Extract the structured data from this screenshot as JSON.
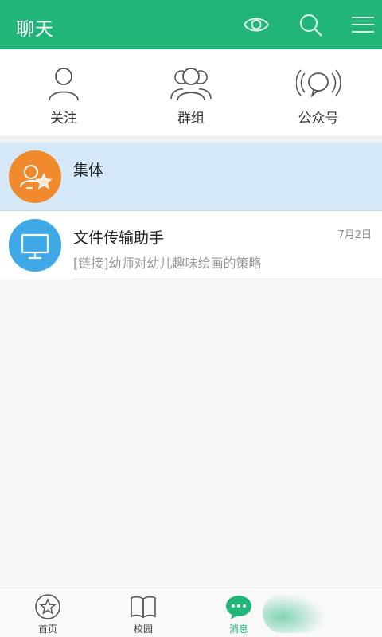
{
  "header": {
    "title": "聊天",
    "icons": [
      "eye-icon",
      "search-icon",
      "menu-icon"
    ],
    "color": "#21b57a"
  },
  "quick_actions": [
    {
      "label": "关注",
      "icon": "person-icon"
    },
    {
      "label": "群组",
      "icon": "group-icon"
    },
    {
      "label": "公众号",
      "icon": "broadcast-icon"
    }
  ],
  "chats": [
    {
      "name": "集体",
      "time": "",
      "preview": "",
      "avatar_color": "#f08a2c",
      "icon": "collective-star-icon",
      "selected": true
    },
    {
      "name": "文件传输助手",
      "time": "7月2日",
      "preview": "[链接]幼师对幼儿趣味绘画的策略",
      "avatar_color": "#3fa9e8",
      "icon": "monitor-icon",
      "selected": false
    }
  ],
  "tabbar": {
    "tabs": [
      {
        "label": "首页",
        "icon": "star-circle-icon",
        "active": false
      },
      {
        "label": "校园",
        "icon": "book-icon",
        "active": false
      },
      {
        "label": "消息",
        "icon": "chat-bubble-icon",
        "active": true
      }
    ]
  }
}
